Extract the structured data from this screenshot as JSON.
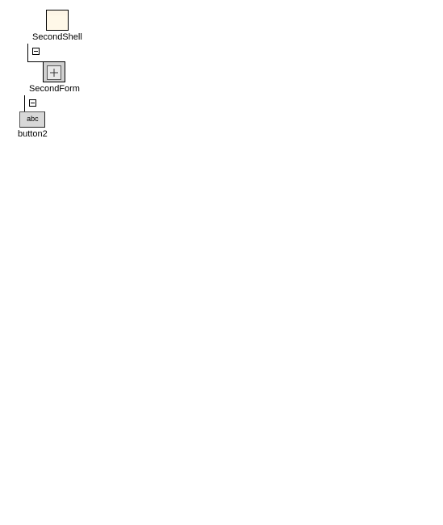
{
  "tree": {
    "node1": {
      "label": "SecondShell",
      "icon": "shell"
    },
    "node2": {
      "label": "SecondForm",
      "icon": "form"
    },
    "node3": {
      "label": "button2",
      "icon": "button",
      "iconText": "abc"
    }
  }
}
